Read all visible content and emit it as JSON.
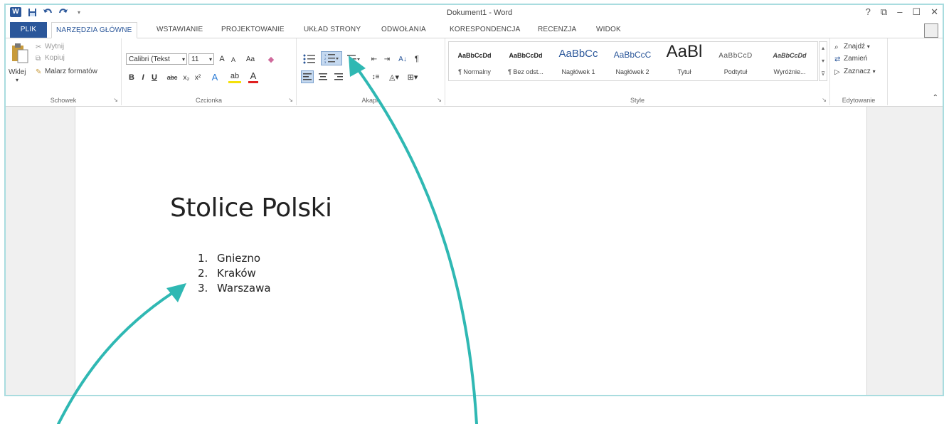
{
  "window": {
    "title": "Dokument1 - Word",
    "controls": [
      "?",
      "⧉",
      "–",
      "☐",
      "✕"
    ]
  },
  "quick_access": {
    "icons": [
      "word-logo",
      "save-icon",
      "undo-icon",
      "redo-icon",
      "customize-icon"
    ]
  },
  "tabs": {
    "file": "PLIK",
    "items": [
      "NARZĘDZIA GŁÓWNE",
      "WSTAWIANIE",
      "PROJEKTOWANIE",
      "UKŁAD STRONY",
      "ODWOŁANIA",
      "KORESPONDENCJA",
      "RECENZJA",
      "WIDOK"
    ],
    "active": "NARZĘDZIA GŁÓWNE"
  },
  "ribbon": {
    "clipboard": {
      "label": "Schowek",
      "paste": "Wklej",
      "cut": "Wytnij",
      "copy": "Kopiuj",
      "format_painter": "Malarz formatów"
    },
    "font": {
      "label": "Czcionka",
      "font_name": "Calibri (Tekst",
      "font_size": "11",
      "grow": "A",
      "shrink": "A",
      "case": "Aa",
      "bold": "B",
      "italic": "I",
      "underline": "U",
      "strike": "abc",
      "subscript": "x₂",
      "superscript": "x²",
      "effects": "A",
      "highlight": "ab",
      "color": "A"
    },
    "paragraph": {
      "label": "Akapit",
      "sort": "A↓",
      "pilcrow": "¶"
    },
    "styles": {
      "label": "Style",
      "items": [
        {
          "sample": "AaBbCcDd",
          "name": "¶ Normalny"
        },
        {
          "sample": "AaBbCcDd",
          "name": "¶ Bez odst..."
        },
        {
          "sample": "AaBbCc",
          "name": "Nagłówek 1"
        },
        {
          "sample": "AaBbCcC",
          "name": "Nagłówek 2"
        },
        {
          "sample": "AaBl",
          "name": "Tytuł"
        },
        {
          "sample": "AaBbCcD",
          "name": "Podtytuł"
        },
        {
          "sample": "AaBbCcDd",
          "name": "Wyróżnie..."
        }
      ]
    },
    "editing": {
      "label": "Edytowanie",
      "find": "Znajdź",
      "replace": "Zamień",
      "select": "Zaznacz"
    }
  },
  "document": {
    "title": "Stolice Polski",
    "list": [
      {
        "num": "1.",
        "text": "Gniezno"
      },
      {
        "num": "2.",
        "text": "Kraków"
      },
      {
        "num": "3.",
        "text": "Warszawa"
      }
    ]
  },
  "colors": {
    "accent": "#2b579a",
    "arrow": "#2fb8b3",
    "frame": "#a9dcdf"
  }
}
